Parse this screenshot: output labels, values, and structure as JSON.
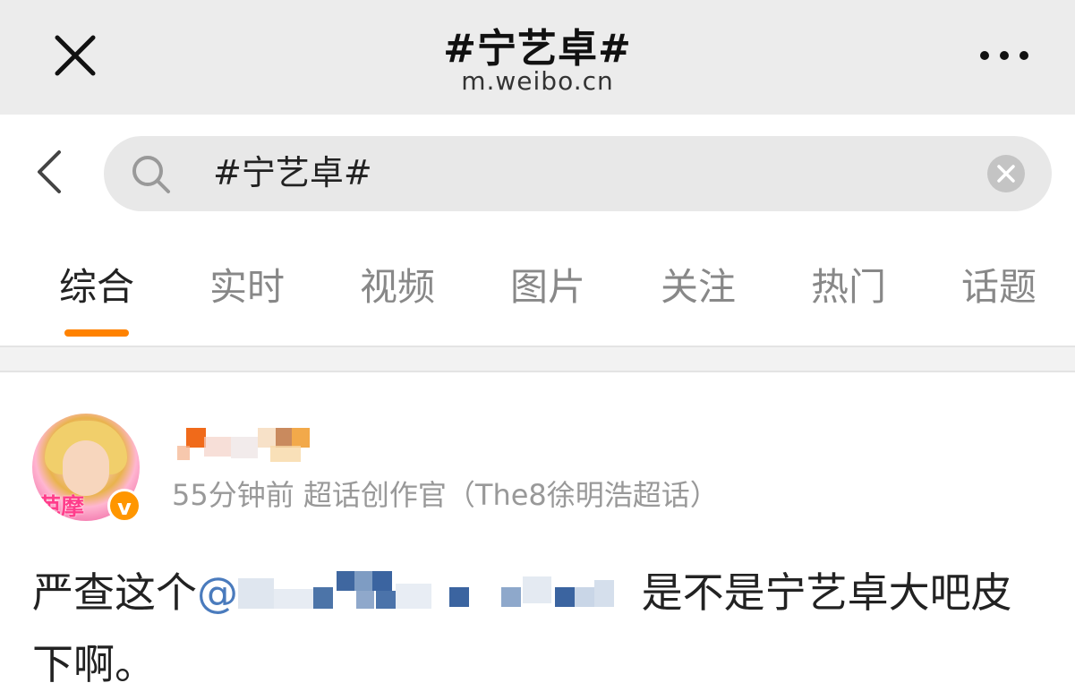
{
  "browser": {
    "title": "#宁艺卓#",
    "url": "m.weibo.cn",
    "close_icon": "close-icon",
    "more_icon": "more-icon"
  },
  "search": {
    "query": "#宁艺卓#",
    "back_icon": "chevron-left-icon",
    "search_icon": "search-icon",
    "clear_icon": "clear-icon"
  },
  "tabs": [
    {
      "label": "综合",
      "active": true
    },
    {
      "label": "实时",
      "active": false
    },
    {
      "label": "视频",
      "active": false
    },
    {
      "label": "图片",
      "active": false
    },
    {
      "label": "关注",
      "active": false
    },
    {
      "label": "热门",
      "active": false
    },
    {
      "label": "话题",
      "active": false
    }
  ],
  "post": {
    "avatar_text": "芭摩",
    "verified_badge": "v",
    "meta": "55分钟前 超话创作官（The8徐明浩超话）",
    "text_prefix": "严查这个",
    "mention_at": "@",
    "text_suffix": " 是不是宁艺卓大吧皮下啊。"
  },
  "colors": {
    "accent": "#ff8200",
    "link": "#4a7bbd",
    "header_bg": "#ececec"
  }
}
